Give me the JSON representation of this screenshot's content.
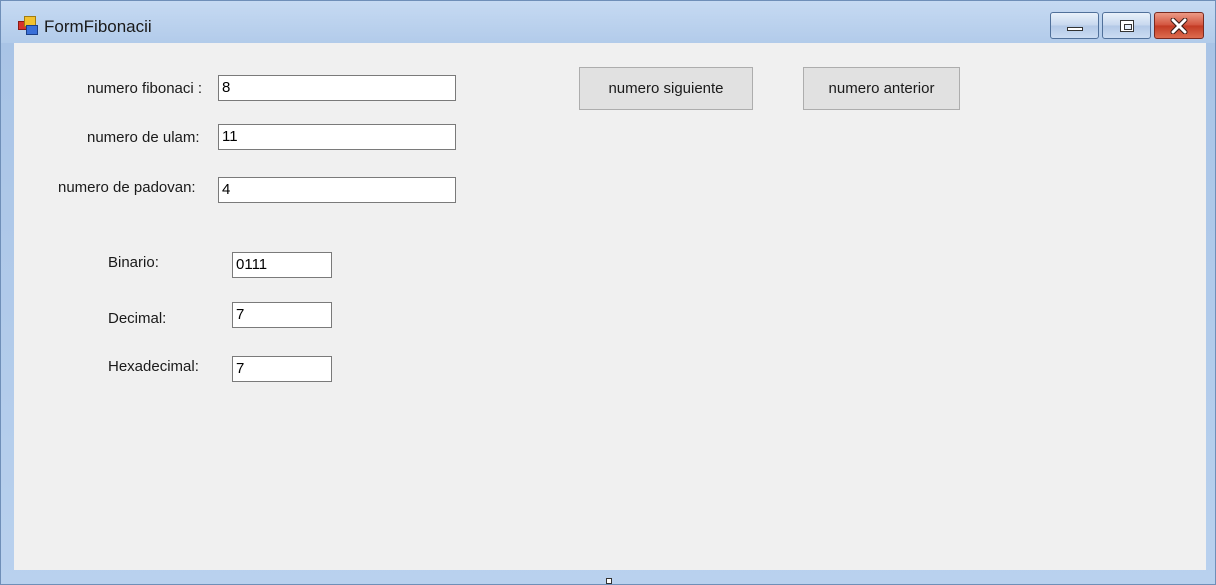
{
  "window": {
    "title": "FormFibonacii",
    "icon": "winforms-app-icon"
  },
  "form": {
    "fibonacci": {
      "label": "numero fibonaci :",
      "value": "8"
    },
    "ulam": {
      "label": "numero de ulam:",
      "value": "11"
    },
    "padovan": {
      "label": "numero de padovan:",
      "value": "4"
    },
    "binario": {
      "label": "Binario:",
      "value": "0111"
    },
    "decimal": {
      "label": "Decimal:",
      "value": "7"
    },
    "hexadecimal": {
      "label": "Hexadecimal:",
      "value": "7"
    }
  },
  "buttons": {
    "next": "numero siguiente",
    "previous": "numero anterior"
  },
  "colors": {
    "client_background": "#f0f0f0",
    "titlebar": "#b9d1ee",
    "close_button": "#c94a33"
  }
}
